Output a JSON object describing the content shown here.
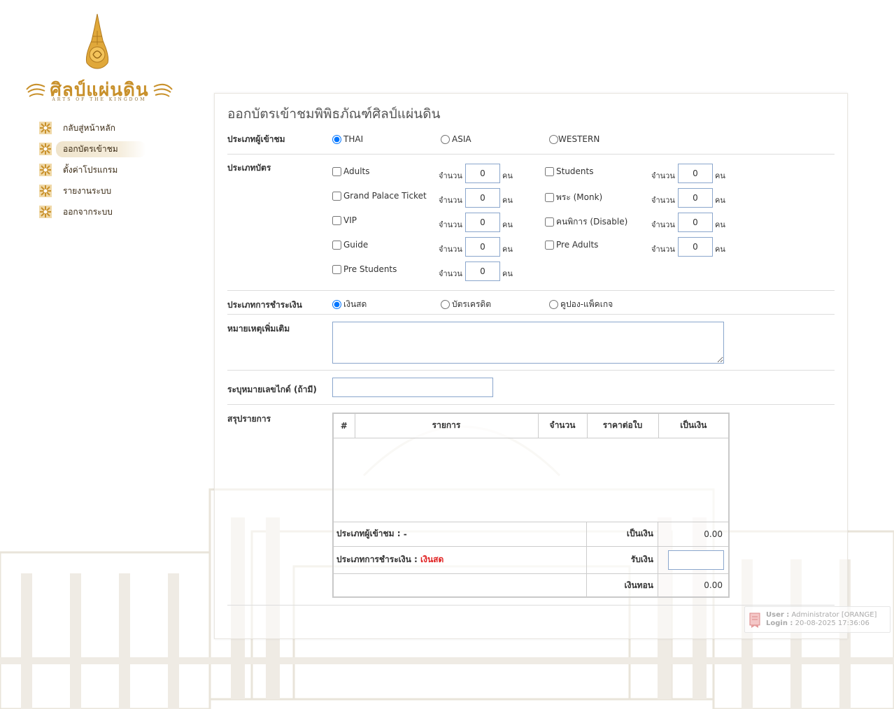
{
  "logo": {
    "title": "ศิลป์แผ่นดิน",
    "subtitle": "ARTS OF THE KINGDOM"
  },
  "menu": [
    {
      "label": "กลับสู่หน้าหลัก",
      "active": false
    },
    {
      "label": "ออกบัตรเข้าชม",
      "active": true
    },
    {
      "label": "ตั้งค่าโปรแกรม",
      "active": false
    },
    {
      "label": "รายงานระบบ",
      "active": false
    },
    {
      "label": "ออกจากระบบ",
      "active": false
    }
  ],
  "page": {
    "title": "ออกบัตรเข้าชมพิพิธภัณฑ์ศิลป์แผ่นดิน"
  },
  "visitor_type": {
    "label": "ประเภทผู้เข้าชม",
    "options": [
      {
        "label": "THAI",
        "checked": true
      },
      {
        "label": "ASIA",
        "checked": false
      },
      {
        "label": "WESTERN",
        "checked": false
      }
    ]
  },
  "ticket_type": {
    "label": "ประเภทบัตร",
    "qty_label": "จำนวน",
    "unit_label": "คน",
    "left": [
      {
        "label": "Adults",
        "qty": "0"
      },
      {
        "label": "Grand Palace Ticket",
        "qty": "0"
      },
      {
        "label": "VIP",
        "qty": "0"
      },
      {
        "label": "Guide",
        "qty": "0"
      },
      {
        "label": "Pre Students",
        "qty": "0"
      }
    ],
    "right": [
      {
        "label": "Students",
        "qty": "0"
      },
      {
        "label": "พระ (Monk)",
        "qty": "0"
      },
      {
        "label": "คนพิการ (Disable)",
        "qty": "0"
      },
      {
        "label": "Pre Adults",
        "qty": "0"
      }
    ]
  },
  "payment_type": {
    "label": "ประเภทการชำระเงิน",
    "options": [
      {
        "label": "เงินสด",
        "checked": true
      },
      {
        "label": "บัตรเครดิต",
        "checked": false
      },
      {
        "label": "คูปอง-แพ็คเกจ",
        "checked": false
      }
    ]
  },
  "note": {
    "label": "หมายเหตุเพิ่มเติม",
    "value": ""
  },
  "guide_no": {
    "label": "ระบุหมายเลขไกด์ (ถ้ามี)",
    "value": ""
  },
  "summary": {
    "label": "สรุปรายการ",
    "columns": [
      "#",
      "รายการ",
      "จำนวน",
      "ราคาต่อใบ",
      "เป็นเงิน"
    ],
    "visitor_type_label": "ประเภทผู้เข้าชม :",
    "visitor_type_value": "-",
    "payment_label": "ประเภทการชำระเงิน :",
    "payment_value": "เงินสด",
    "amount_label": "เป็นเงิน",
    "amount_value": "0.00",
    "received_label": "รับเงิน",
    "received_value": "",
    "change_label": "เงินทอน",
    "change_value": "0.00"
  },
  "user_info": {
    "user_label": "User :",
    "user_value": "Administrator [ORANGE]",
    "login_label": "Login :",
    "login_value": "20-08-2025 17:36:06"
  },
  "colors": {
    "accent_gold": "#c8902a",
    "input_border": "#8aa6cc",
    "payment_highlight": "#e02020"
  }
}
